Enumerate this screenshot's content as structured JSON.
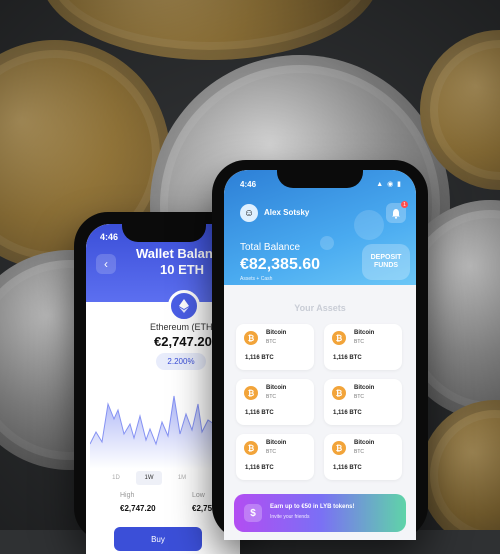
{
  "wallet_screen": {
    "time": "4:46",
    "title": "Wallet Balan",
    "subtitle": "10 ETH",
    "coin_name": "Ethereum (ETH)",
    "price": "€2,747.20",
    "change": "2.200%",
    "periods": [
      "1D",
      "1W",
      "1M"
    ],
    "active_period": "1W",
    "high_label": "High",
    "high_value": "€2,747.20",
    "low_label": "Low",
    "low_value": "€2,75",
    "buy_label": "Buy",
    "accent_color": "#3b4fd8"
  },
  "home_screen": {
    "time": "4:46",
    "status_icons": "▲ ◉ ▮",
    "user_name": "Alex Sotsky",
    "notification_count": "1",
    "total_label": "Total Balance",
    "total_value": "€82,385.60",
    "total_sub": "Assets + Cash",
    "deposit_label": "DEPOSIT FUNDS",
    "assets_title": "Your Assets",
    "assets": [
      {
        "name": "Bitcoin",
        "symbol": "BTC",
        "amount": "1,116 BTC"
      },
      {
        "name": "Bitcoin",
        "symbol": "BTC",
        "amount": "1,116 BTC"
      },
      {
        "name": "Bitcoin",
        "symbol": "BTC",
        "amount": "1,116 BTC"
      },
      {
        "name": "Bitcoin",
        "symbol": "BTC",
        "amount": "1,116 BTC"
      },
      {
        "name": "Bitcoin",
        "symbol": "BTC",
        "amount": "1,116 BTC"
      },
      {
        "name": "Bitcoin",
        "symbol": "BTC",
        "amount": "1,116 BTC"
      }
    ],
    "promo_title": "Earn up to €50 in LYB tokens!",
    "promo_sub": "Invite your friends",
    "header_color": "#2d7fd6"
  }
}
